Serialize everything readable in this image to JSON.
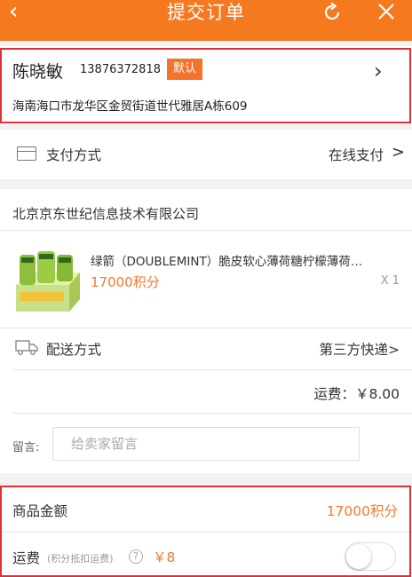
{
  "header": {
    "title": "提交订单",
    "back_icon": "chevron-left-icon",
    "refresh_icon": "refresh-icon",
    "close_icon": "close-icon",
    "background": "#f57a1f"
  },
  "address": {
    "name": "陈晓敏",
    "phone": "13876372818",
    "default_badge": "默认",
    "detail": "海南海口市龙华区金贸街道世代雅居A栋609",
    "chevron": "›"
  },
  "payment": {
    "label": "支付方式",
    "value": "在线支付",
    "arrow": ">"
  },
  "order": {
    "shop_name": "北京京东世纪信息技术有限公司",
    "product": {
      "name": "绿箭（DOUBLEMINT）脆皮软心薄荷糖柠檬薄荷…",
      "points": "17000积分",
      "quantity": "X 1"
    },
    "shipping": {
      "label": "配送方式",
      "value": "第三方快递>"
    },
    "freight": "运费：￥8.00",
    "message": {
      "label": "留言:",
      "placeholder": "给卖家留言",
      "value": ""
    }
  },
  "summary": {
    "goods_label": "商品金额",
    "goods_value": "17000积分",
    "fee_label": "运费",
    "fee_note": "(积分抵扣运费)",
    "help": "?",
    "fee_amount": "￥8",
    "points_deduct_toggle": false
  },
  "colors": {
    "accent": "#f27a2c",
    "highlight_border": "#e0303a"
  }
}
